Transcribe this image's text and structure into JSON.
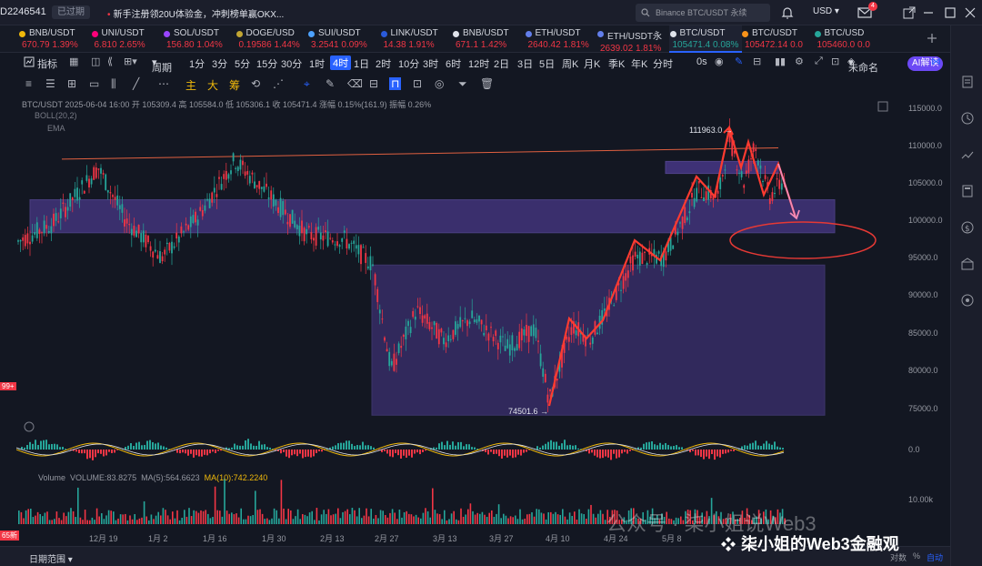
{
  "topbar": {
    "uid": "D2246541",
    "expired": "已过期",
    "notice": "新手注册领20U体验金，冲刺榜单赢OKX...",
    "search": "Binance BTC/USDT 永续",
    "currency": "USD",
    "mail_badge": "4"
  },
  "tabs": [
    {
      "symbol": "BNB/USDT",
      "price": "670.79",
      "change": "1.39%",
      "dir": "up",
      "color": "#f0b90b"
    },
    {
      "symbol": "UNI/USDT",
      "price": "6.810",
      "change": "2.65%",
      "dir": "up",
      "color": "#ff007a"
    },
    {
      "symbol": "SOL/USDT",
      "price": "156.80",
      "change": "1.04%",
      "dir": "up",
      "color": "#9945ff"
    },
    {
      "symbol": "DOGE/USD",
      "price": "0.19586",
      "change": "1.44%",
      "dir": "up",
      "color": "#c2a633"
    },
    {
      "symbol": "SUI/USDT",
      "price": "3.2541",
      "change": "0.09%",
      "dir": "up",
      "color": "#4da2ff"
    },
    {
      "symbol": "LINK/USDT",
      "price": "14.38",
      "change": "1.91%",
      "dir": "up",
      "color": "#2a5ada"
    },
    {
      "symbol": "BNB/USDT",
      "price": "671.1",
      "change": "1.42%",
      "dir": "up",
      "color": "#e0e3eb"
    },
    {
      "symbol": "ETH/USDT",
      "price": "2640.42",
      "change": "1.81%",
      "dir": "up",
      "color": "#627eea"
    },
    {
      "symbol": "ETH/USDT永",
      "price": "2639.02",
      "change": "1.81%",
      "dir": "up",
      "color": "#627eea"
    },
    {
      "symbol": "BTC/USDT",
      "price": "105471.4",
      "change": "0.08%",
      "dir": "up",
      "color": "#e0e3eb",
      "active": true
    },
    {
      "symbol": "BTC/USDT",
      "price": "105472.14",
      "change": "0.0",
      "dir": "dn",
      "color": "#f7931a"
    },
    {
      "symbol": "BTC/USD",
      "price": "105460.0",
      "change": "0.0",
      "dir": "dn",
      "color": "#26a69a"
    }
  ],
  "toolbar1": {
    "indicators": "指标",
    "period": "周期",
    "intervals": [
      "1分",
      "3分",
      "5分",
      "15分",
      "30分",
      "1时",
      "4时",
      "1日",
      "2时",
      "10分",
      "3时",
      "6时",
      "12时",
      "2日",
      "3日",
      "5日",
      "周K",
      "月K",
      "季K",
      "年K",
      "分时"
    ],
    "selected_interval": "4时",
    "seconds": "0s",
    "unnamed": "未命名",
    "ai": "AI解读"
  },
  "toolbar2": {
    "labels": [
      "主",
      "大",
      "筹"
    ]
  },
  "legend": {
    "line": "BTC/USDT  2025-06-04 16:00  开 105309.4  高 105584.0  低 105306.1  收 105471.4  涨幅 0.15%(161.9)  振幅 0.26%",
    "boll": "BOLL(20,2)",
    "ema": "EMA"
  },
  "price_axis": [
    "115000.0",
    "110000.0",
    "105000.0",
    "100000.0",
    "95000.0",
    "90000.0",
    "85000.0",
    "80000.0",
    "75000.0",
    "0.0",
    "10.00k"
  ],
  "time_axis": [
    "12月 19",
    "1月 2",
    "1月 16",
    "1月 30",
    "2月 13",
    "2月 27",
    "3月 13",
    "3月 27",
    "4月 10",
    "4月 24",
    "5月 8"
  ],
  "annotations": {
    "high": "111963.0 →",
    "low": "74501.6 →"
  },
  "volume": {
    "label": "Volume",
    "vol": "VOLUME:83.8275",
    "ma5": "MA(5):564.6623",
    "ma10": "MA(10):742.2240"
  },
  "left_marks": [
    "99+",
    "65新"
  ],
  "bottom": {
    "range": "日期范围",
    "logscale": "对数",
    "percent": "%",
    "auto": "自动"
  },
  "watermark": {
    "gzh": "公众号 · 柒小姐说Web3",
    "brand": "柒小姐的Web3金融观"
  },
  "colors": {
    "up": "#26a69a",
    "down": "#f23645",
    "zone": "#7b5cd6",
    "accent": "#2962ff"
  }
}
